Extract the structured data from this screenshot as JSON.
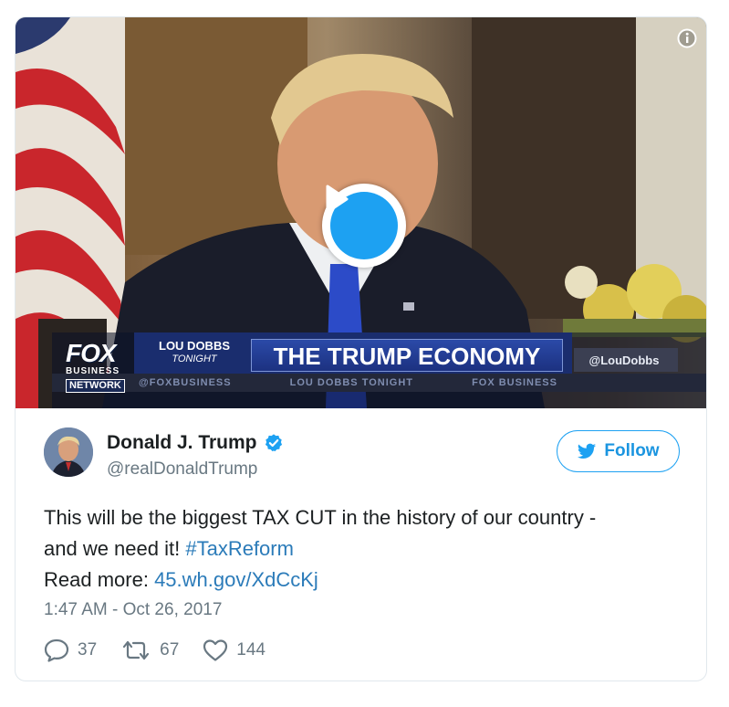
{
  "media": {
    "chyron": {
      "network_logo": "FOX",
      "network_business": "BUSINESS",
      "network_label": "NETWORK",
      "show_line1": "LOU DOBBS",
      "show_line2": "TONIGHT",
      "headline": "THE TRUMP ECONOMY",
      "handle": "@LouDobbs",
      "ticker": [
        "@FOXBUSINESS",
        "LOU DOBBS TONIGHT",
        "FOX BUSINESS"
      ]
    },
    "play_icon": "play-icon",
    "info_icon": "info-icon"
  },
  "author": {
    "display_name": "Donald J. Trump",
    "handle": "@realDonaldTrump",
    "verified": true,
    "verified_color": "#1da1f2"
  },
  "follow_button": {
    "label": "Follow",
    "icon": "twitter-bird-icon",
    "color": "#1da1f2"
  },
  "tweet": {
    "text_line1": "This will be the biggest TAX CUT in the history of our country -",
    "text_line2_prefix": "and we need it! ",
    "hashtag": "#TaxReform",
    "read_more_prefix": "Read more: ",
    "link": "45.wh.gov/XdCcKj",
    "link_color": "#2b7bb9",
    "timestamp": "1:47 AM - Oct 26, 2017"
  },
  "stats": {
    "replies": "37",
    "retweets": "67",
    "likes": "144"
  }
}
